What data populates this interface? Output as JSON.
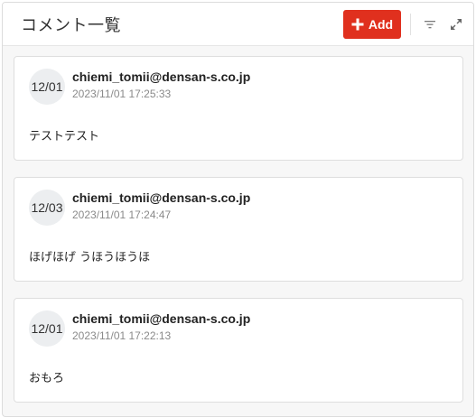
{
  "header": {
    "title": "コメント一覧",
    "add_label": "Add",
    "add_icon": "plus-icon",
    "filter_icon": "filter-icon",
    "expand_icon": "expand-icon",
    "accent": "#e0301e"
  },
  "comments": [
    {
      "avatar": "12/01",
      "author": "chiemi_tomii@densan-s.co.jp",
      "timestamp": "2023/11/01 17:25:33",
      "text": "テストテスト"
    },
    {
      "avatar": "12/03",
      "author": "chiemi_tomii@densan-s.co.jp",
      "timestamp": "2023/11/01 17:24:47",
      "text": "ほげほげ うほうほうほ"
    },
    {
      "avatar": "12/01",
      "author": "chiemi_tomii@densan-s.co.jp",
      "timestamp": "2023/11/01 17:22:13",
      "text": "おもろ"
    }
  ]
}
